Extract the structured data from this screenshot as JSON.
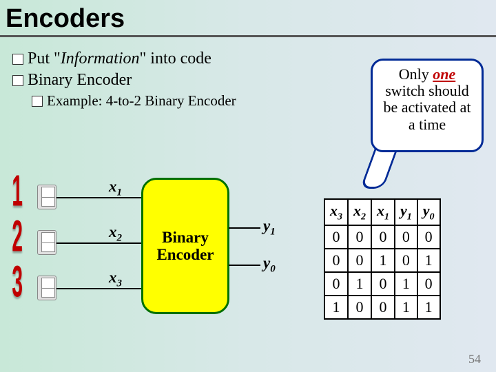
{
  "title": "Encoders",
  "bullets": {
    "b1_prefix": "Put \"",
    "b1_italic": "Information",
    "b1_suffix": "\" into code",
    "b2": "Binary Encoder",
    "b3": "Example: 4-to-2 Binary Encoder"
  },
  "callout": {
    "line1a": "Only ",
    "line1b": "one",
    "line2": " switch should be activated at a time"
  },
  "diagram": {
    "switch_nums": [
      "1",
      "2",
      "3"
    ],
    "x_labels": [
      "x",
      "x",
      "x"
    ],
    "x_subs": [
      "1",
      "2",
      "3"
    ],
    "box_label": "Binary Encoder",
    "y_labels": [
      "y",
      "y"
    ],
    "y_subs": [
      "1",
      "0"
    ]
  },
  "table": {
    "headers_x": [
      "x",
      "x",
      "x"
    ],
    "headers_x_sub": [
      "3",
      "2",
      "1"
    ],
    "headers_y": [
      "y",
      "y"
    ],
    "headers_y_sub": [
      "1",
      "0"
    ],
    "rows": [
      [
        "0",
        "0",
        "0",
        "0",
        "0"
      ],
      [
        "0",
        "0",
        "1",
        "0",
        "1"
      ],
      [
        "0",
        "1",
        "0",
        "1",
        "0"
      ],
      [
        "1",
        "0",
        "0",
        "1",
        "1"
      ]
    ]
  },
  "page_num": "54"
}
